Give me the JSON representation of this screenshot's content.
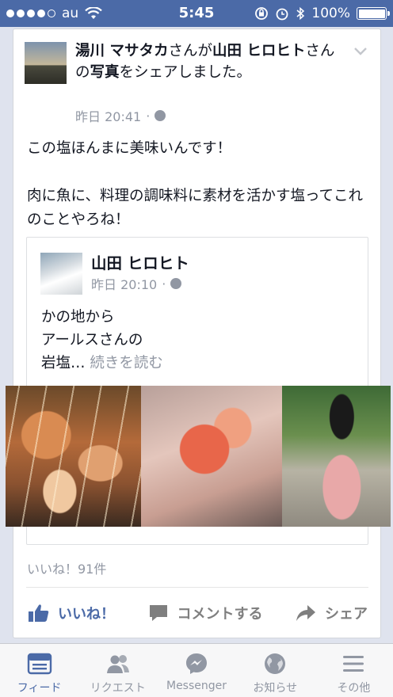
{
  "status_bar": {
    "carrier": "au",
    "time": "5:45",
    "battery": "100%"
  },
  "post": {
    "author": "湯川 マサタカ",
    "title_mid1": "さんが",
    "shared_from": "山田 ヒロヒト",
    "title_mid2": "さんの",
    "object": "写真",
    "title_end": "をシェアしました。",
    "timestamp": "昨日 20:41",
    "separator": "·",
    "body": "この塩ほんまに美味いんです！\n\n肉に魚に、料理の調味料に素材を活かす塩ってこれのことやろね！",
    "shared": {
      "name": "山田 ヒロヒト",
      "timestamp": "昨日 20:10",
      "separator": "·",
      "body": "かの地から\nアールスさんの\n岩塩…",
      "read_more": "続きを読む"
    },
    "likes_count": "いいね！91件",
    "actions": {
      "like": "いいね！",
      "comment": "コメントする",
      "share": "シェア"
    }
  },
  "tabbar": {
    "items": [
      {
        "label": "フィード",
        "icon": "news-feed-icon",
        "active": true
      },
      {
        "label": "リクエスト",
        "icon": "friend-requests-icon"
      },
      {
        "label": "Messenger",
        "icon": "messenger-icon"
      },
      {
        "label": "お知らせ",
        "icon": "notifications-globe-icon"
      },
      {
        "label": "その他",
        "icon": "more-menu-icon"
      }
    ]
  },
  "colors": {
    "brand": "#4b6aa7",
    "muted": "#9197a3",
    "background": "#dfe3ee"
  }
}
